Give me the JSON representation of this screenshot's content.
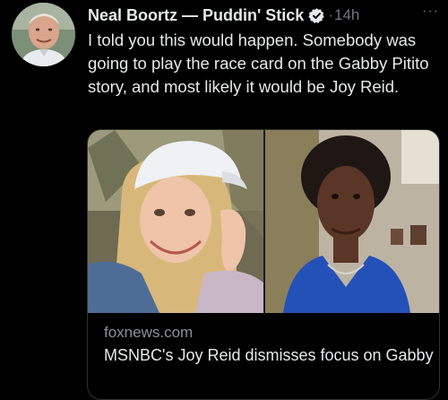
{
  "tweet": {
    "author_name": "Neal Boortz — Puddin' Stick",
    "separator": "·",
    "timestamp": "14h",
    "more_label": "···",
    "text": "I told you this would happen. Somebody was going to play the race card on the Gabby Pitito story, and most likely it would be Joy Reid."
  },
  "link_card": {
    "domain": "foxnews.com",
    "title": "MSNBC's Joy Reid dismisses focus on Gabby Petito case as 'missing White..."
  },
  "colors": {
    "background": "#000000",
    "text_primary": "#e7e9ea",
    "text_secondary": "#71767b",
    "verified_badge": "#e7e9ea",
    "card_border": "#2f3336"
  },
  "icons": {
    "verified": "verified-badge-icon",
    "more": "more-horizontal-icon"
  }
}
